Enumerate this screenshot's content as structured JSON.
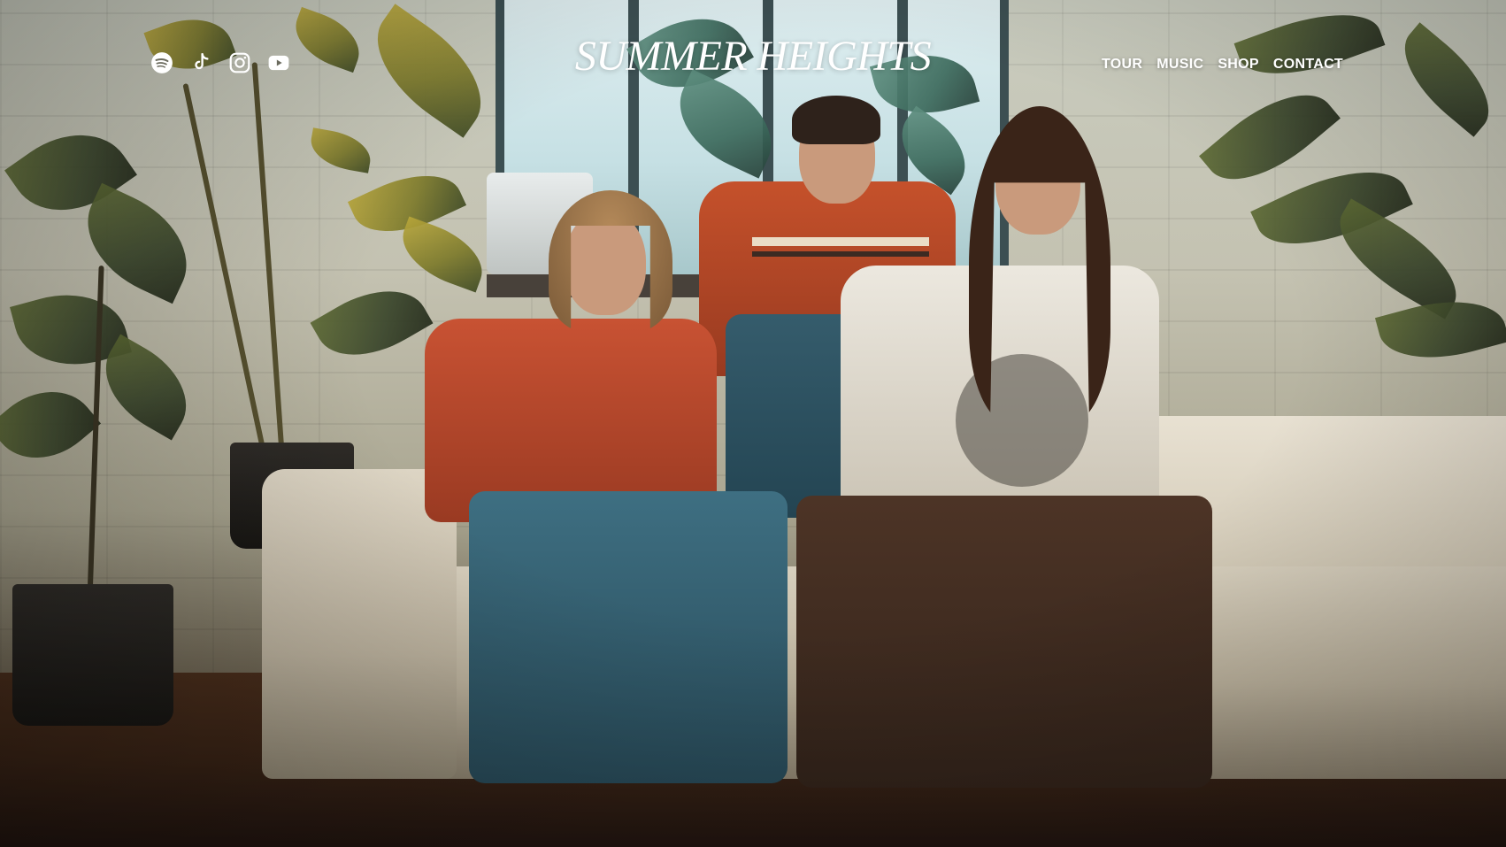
{
  "site": {
    "title": "SUMMER HEIGHTS"
  },
  "social": [
    {
      "name": "spotify-icon"
    },
    {
      "name": "tiktok-icon"
    },
    {
      "name": "instagram-icon"
    },
    {
      "name": "youtube-icon"
    }
  ],
  "nav": {
    "items": [
      {
        "label": "TOUR"
      },
      {
        "label": "MUSIC"
      },
      {
        "label": "SHOP"
      },
      {
        "label": "CONTACT"
      }
    ]
  },
  "hero": {
    "image_subject": "band-photo"
  },
  "colors": {
    "text": "#ffffff"
  }
}
